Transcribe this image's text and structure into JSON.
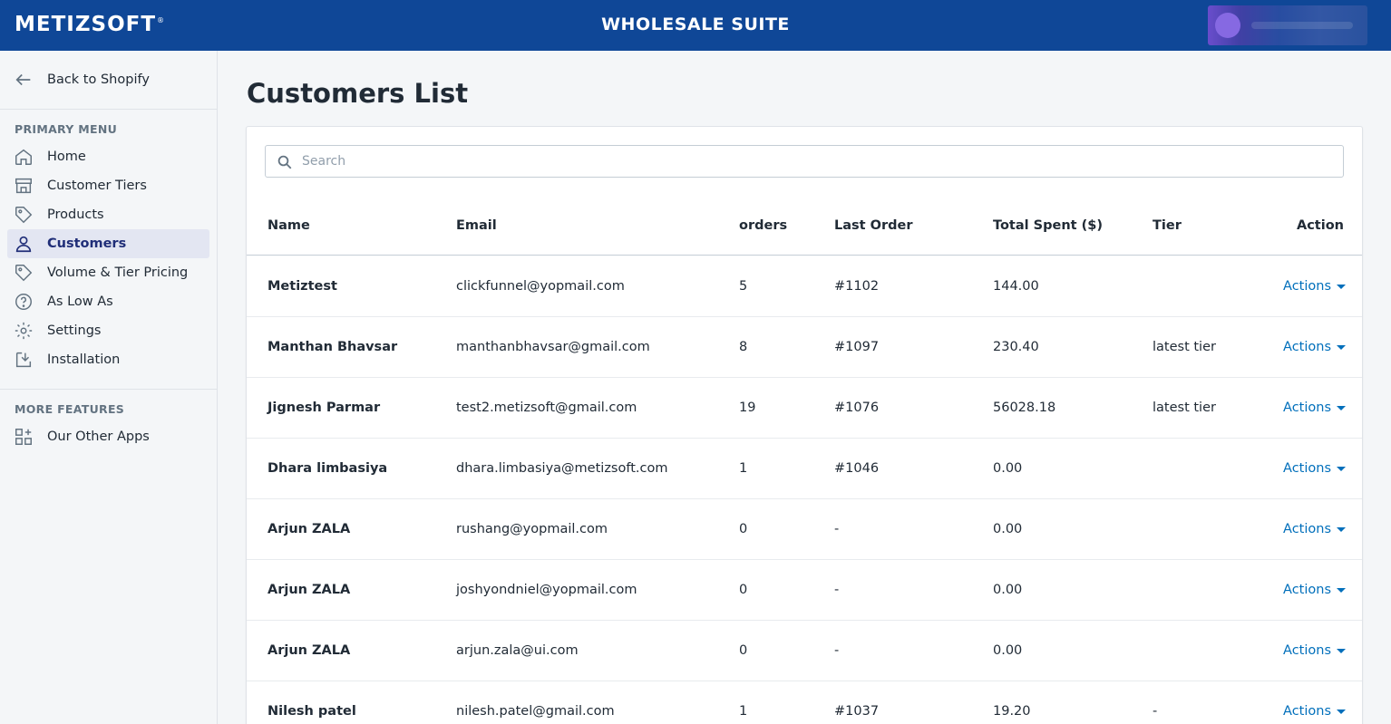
{
  "header": {
    "logo": "METIZSOFT",
    "logo_mark": "®",
    "app_title": "WHOLESALE SUITE"
  },
  "sidebar": {
    "back_label": "Back to Shopify",
    "primary_title": "PRIMARY MENU",
    "items": [
      {
        "label": "Home",
        "icon": "home-icon"
      },
      {
        "label": "Customer Tiers",
        "icon": "store-icon"
      },
      {
        "label": "Products",
        "icon": "tag-icon"
      },
      {
        "label": "Customers",
        "icon": "person-icon",
        "active": true
      },
      {
        "label": "Volume & Tier Pricing",
        "icon": "price-tag-icon"
      },
      {
        "label": "As Low As",
        "icon": "question-circle-icon"
      },
      {
        "label": "Settings",
        "icon": "gear-icon"
      },
      {
        "label": "Installation",
        "icon": "install-icon"
      }
    ],
    "more_title": "MORE FEATURES",
    "more_items": [
      {
        "label": "Our Other Apps",
        "icon": "apps-icon"
      }
    ]
  },
  "main": {
    "title": "Customers List",
    "search": {
      "placeholder": "Search",
      "value": ""
    },
    "table": {
      "columns": [
        "Name",
        "Email",
        "orders",
        "Last Order",
        "Total Spent ($)",
        "Tier",
        "Action"
      ],
      "rows": [
        {
          "name": "Metiztest",
          "email": "clickfunnel@yopmail.com",
          "orders": "5",
          "last_order": "#1102",
          "total": "144.00",
          "tier": "",
          "action": "Actions"
        },
        {
          "name": "Manthan Bhavsar",
          "email": "manthanbhavsar@gmail.com",
          "orders": "8",
          "last_order": "#1097",
          "total": "230.40",
          "tier": "latest tier",
          "action": "Actions"
        },
        {
          "name": "Jignesh Parmar",
          "email": "test2.metizsoft@gmail.com",
          "orders": "19",
          "last_order": "#1076",
          "total": "56028.18",
          "tier": "latest tier",
          "action": "Actions"
        },
        {
          "name": "Dhara limbasiya",
          "email": "dhara.limbasiya@metizsoft.com",
          "orders": "1",
          "last_order": "#1046",
          "total": "0.00",
          "tier": "",
          "action": "Actions"
        },
        {
          "name": "Arjun ZALA",
          "email": "rushang@yopmail.com",
          "orders": "0",
          "last_order": "-",
          "total": "0.00",
          "tier": "",
          "action": "Actions"
        },
        {
          "name": "Arjun ZALA",
          "email": "joshyondniel@yopmail.com",
          "orders": "0",
          "last_order": "-",
          "total": "0.00",
          "tier": "",
          "action": "Actions"
        },
        {
          "name": "Arjun ZALA",
          "email": "arjun.zala@ui.com",
          "orders": "0",
          "last_order": "-",
          "total": "0.00",
          "tier": "",
          "action": "Actions"
        },
        {
          "name": "Nilesh patel",
          "email": "nilesh.patel@gmail.com",
          "orders": "1",
          "last_order": "#1037",
          "total": "19.20",
          "tier": "-",
          "action": "Actions"
        }
      ]
    }
  },
  "colors": {
    "topbar": "#0f4797",
    "link": "#006fbb",
    "active_nav_bg": "#e3e6f2",
    "active_nav_text": "#202e78"
  }
}
